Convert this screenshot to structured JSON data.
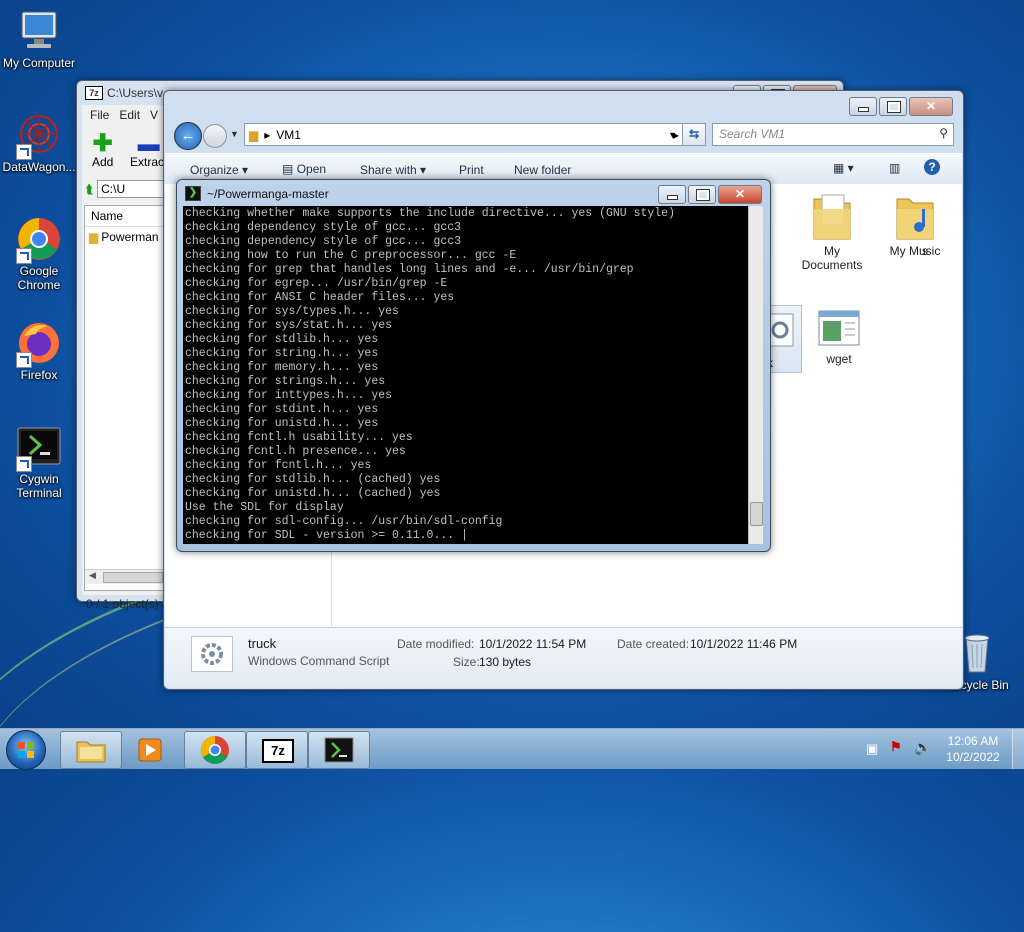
{
  "desktop": {
    "icons": [
      {
        "label": "My Computer"
      },
      {
        "label": "DataWagon..."
      },
      {
        "label": "Google Chrome"
      },
      {
        "label": "Firefox"
      },
      {
        "label": "Cygwin Terminal"
      },
      {
        "label": "Recycle Bin"
      }
    ]
  },
  "sevenzip": {
    "title": "C:\\Users\\v",
    "menu": [
      "File",
      "Edit",
      "V"
    ],
    "toolbar": {
      "add": "Add",
      "extract": "Extract"
    },
    "path": "C:\\U",
    "column_name": "Name",
    "row": "Powerman",
    "status": "0 / 1 object(s) s"
  },
  "explorer": {
    "address": "VM1",
    "search_placeholder": "Search VM1",
    "toolbar": {
      "organize": "Organize",
      "open": "Open",
      "share": "Share with",
      "print": "Print",
      "new_folder": "New folder"
    },
    "items": [
      {
        "label": "s"
      },
      {
        "label": "My Documents"
      },
      {
        "label": "My Music"
      },
      {
        "label": "k"
      },
      {
        "label": "wget"
      }
    ],
    "details": {
      "name": "truck",
      "type": "Windows Command Script",
      "date_modified_label": "Date modified:",
      "date_modified": "10/1/2022 11:54 PM",
      "date_created_label": "Date created:",
      "date_created": "10/1/2022 11:46 PM",
      "size_label": "Size:",
      "size": "130 bytes"
    }
  },
  "terminal": {
    "title": "~/Powermanga-master",
    "lines": [
      "checking whether make supports the include directive... yes (GNU style)",
      "checking dependency style of gcc... gcc3",
      "checking dependency style of gcc... gcc3",
      "checking how to run the C preprocessor... gcc -E",
      "checking for grep that handles long lines and -e... /usr/bin/grep",
      "checking for egrep... /usr/bin/grep -E",
      "checking for ANSI C header files... yes",
      "checking for sys/types.h... yes",
      "checking for sys/stat.h... yes",
      "checking for stdlib.h... yes",
      "checking for string.h... yes",
      "checking for memory.h... yes",
      "checking for strings.h... yes",
      "checking for inttypes.h... yes",
      "checking for stdint.h... yes",
      "checking for unistd.h... yes",
      "checking fcntl.h usability... yes",
      "checking fcntl.h presence... yes",
      "checking for fcntl.h... yes",
      "checking for stdlib.h... (cached) yes",
      "checking for unistd.h... (cached) yes",
      "Use the SDL for display",
      "checking for sdl-config... /usr/bin/sdl-config",
      "checking for SDL - version >= 0.11.0... |"
    ]
  },
  "taskbar": {
    "time": "12:06 AM",
    "date": "10/2/2022"
  },
  "colors": {
    "terminal_bg": "#000000",
    "terminal_fg": "#c0c0c0",
    "accent": "#1b5db5"
  }
}
